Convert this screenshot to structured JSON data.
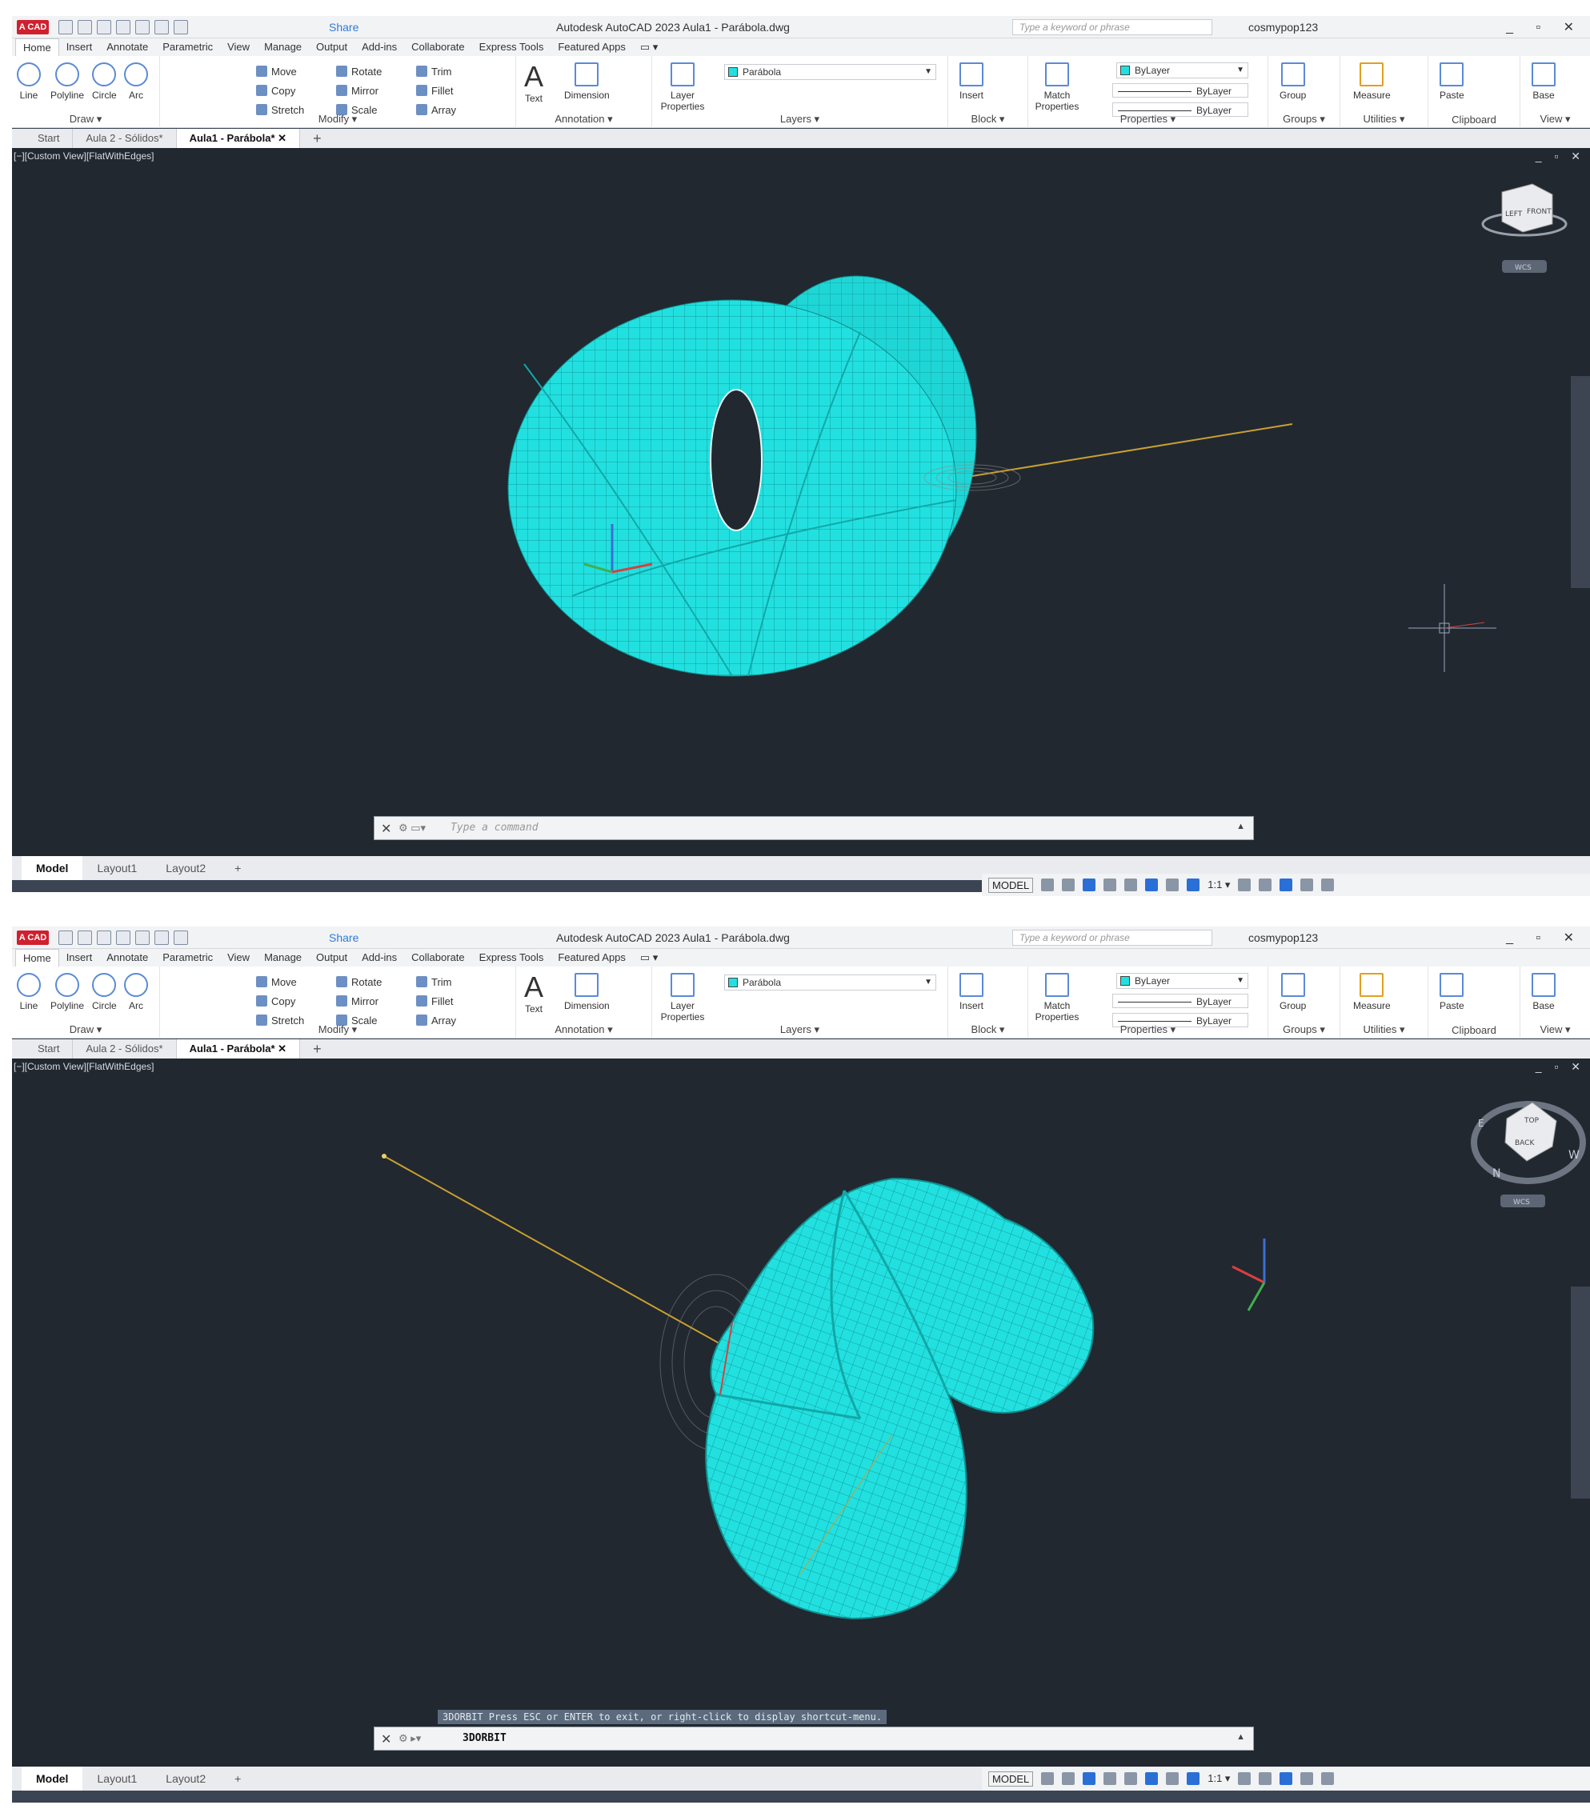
{
  "app": {
    "title": "Autodesk AutoCAD 2023   Aula1 - Parábola.dwg",
    "logo": "A CAD",
    "share": "Share",
    "search_placeholder": "Type a keyword or phrase",
    "user": "cosmypop123",
    "window_controls": "_ ▫ ✕"
  },
  "ribbon_tabs": [
    "Home",
    "Insert",
    "Annotate",
    "Parametric",
    "View",
    "Manage",
    "Output",
    "Add-ins",
    "Collaborate",
    "Express Tools",
    "Featured Apps",
    "▭ ▾"
  ],
  "draw": {
    "line": "Line",
    "polyline": "Polyline",
    "circle": "Circle",
    "arc": "Arc",
    "caption": "Draw ▾"
  },
  "modify": {
    "move": "Move",
    "rotate": "Rotate",
    "trim": "Trim",
    "copy": "Copy",
    "mirror": "Mirror",
    "fillet": "Fillet",
    "stretch": "Stretch",
    "scale": "Scale",
    "array": "Array",
    "caption": "Modify ▾"
  },
  "annotation": {
    "text": "Text",
    "dimension": "Dimension",
    "caption": "Annotation ▾"
  },
  "layers": {
    "layer_properties": "Layer Properties",
    "current_layer": "Parábola",
    "caption": "Layers ▾"
  },
  "block": {
    "insert": "Insert",
    "caption": "Block ▾"
  },
  "properties": {
    "match": "Match Properties",
    "color": "ByLayer",
    "linetype": "ByLayer",
    "lineweight": "ByLayer",
    "caption": "Properties ▾"
  },
  "groups": {
    "group": "Group",
    "caption": "Groups ▾"
  },
  "utilities": {
    "measure": "Measure",
    "caption": "Utilities ▾"
  },
  "clipboard": {
    "paste": "Paste",
    "caption": "Clipboard"
  },
  "view": {
    "base": "Base",
    "caption": "View ▾"
  },
  "file_tabs": {
    "start": "Start",
    "aula2": "Aula 2 - Sólidos*",
    "aula1": "Aula1 - Parábola*",
    "close": "✕",
    "new": "+"
  },
  "viewport": {
    "label": "[−][Custom View][FlatWithEdges]",
    "controls": "_ ▫ ✕",
    "wcs": "WCS"
  },
  "viewcube_a": {
    "face1": "LEFT",
    "face2": "FRONT"
  },
  "viewcube_b": {
    "face1": "TOP",
    "face2": "BACK",
    "n": "N",
    "w": "W",
    "e": "E"
  },
  "command": {
    "placeholder": "Type a command",
    "history_b": "3DORBIT Press ESC or ENTER to exit, or right-click to display shortcut-menu.",
    "current_b": "3DORBIT"
  },
  "layout_tabs": {
    "model": "Model",
    "layout1": "Layout1",
    "layout2": "Layout2",
    "add": "+"
  },
  "status": {
    "model": "MODEL",
    "scale": "1:1 ▾"
  },
  "colors": {
    "surface": "#22e0e0",
    "viewport_bg": "#212830",
    "axis_line": "#c9a030",
    "brand": "#d0202e"
  }
}
